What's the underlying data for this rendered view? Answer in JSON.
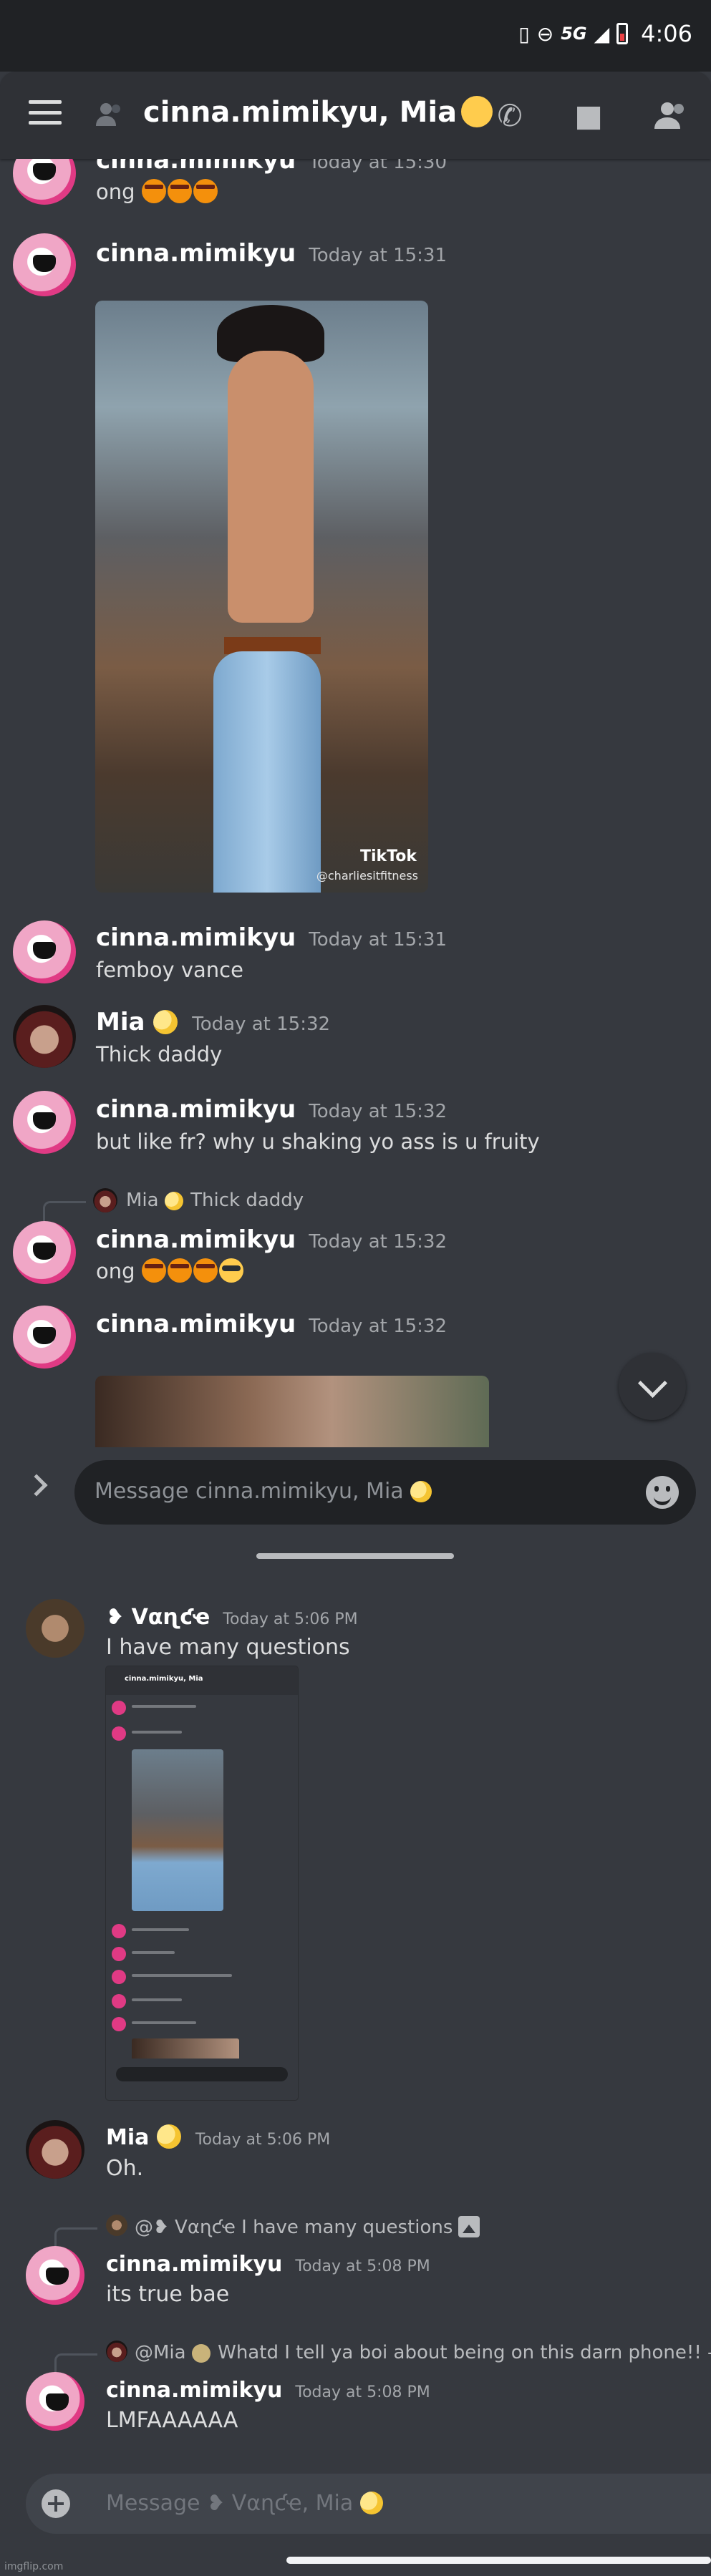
{
  "status_bar": {
    "network": "5G",
    "time": "4:06"
  },
  "panel1": {
    "header": {
      "title": "cinna.mimikyu, Mia"
    },
    "messages": [
      {
        "user": "cinna.mimikyu",
        "time": "Today at 15:30",
        "text": "ong"
      },
      {
        "user": "cinna.mimikyu",
        "time": "Today at 15:31",
        "attachment": {
          "watermark": "TikTok",
          "handle": "@charliesitfitness"
        }
      },
      {
        "user": "cinna.mimikyu",
        "time": "Today at 15:31",
        "text": "femboy vance"
      },
      {
        "user": "Mia",
        "time": "Today at 15:32",
        "text": "Thick daddy"
      },
      {
        "user": "cinna.mimikyu",
        "time": "Today at 15:32",
        "text": "but like fr? why u shaking yo ass is u fruity"
      },
      {
        "reply": {
          "user": "Mia",
          "text": "Thick daddy"
        },
        "user": "cinna.mimikyu",
        "time": "Today at 15:32",
        "text": "ong"
      },
      {
        "user": "cinna.mimikyu",
        "time": "Today at 15:32"
      }
    ],
    "composer": {
      "placeholder": "Message cinna.mimikyu, Mia"
    }
  },
  "panel2": {
    "messages": [
      {
        "user": "❥ Vαɳƈҽ",
        "time": "Today at 5:06 PM",
        "text": "I have many questions"
      },
      {
        "user": "Mia",
        "time": "Today at 5:06 PM",
        "text": "Oh."
      },
      {
        "reply": {
          "user": "@❥ Vαɳƈҽ",
          "text": "I have many questions"
        },
        "user": "cinna.mimikyu",
        "time": "Today at 5:08 PM",
        "text": "its true bae"
      },
      {
        "reply": {
          "user": "@Mia",
          "text": "Whatd I tell ya boi about being on this darn phone!! -"
        },
        "user": "cinna.mimikyu",
        "time": "Today at 5:08 PM",
        "text": "LMFAAAAAA"
      }
    ],
    "composer": {
      "placeholder": "Message ❥ Vαɳƈҽ, Mia"
    }
  },
  "watermark": "imgflip.com",
  "colors": {
    "background": "#36393f",
    "header": "#2f3136",
    "composer": "#40444b",
    "username": "#ffffff",
    "timestamp": "#a3a6aa"
  },
  "icons": [
    "hamburger-icon",
    "dm-icon",
    "call-icon",
    "video-icon",
    "members-icon",
    "chevron-down-icon",
    "emoji-icon",
    "plus-icon",
    "image-icon"
  ]
}
